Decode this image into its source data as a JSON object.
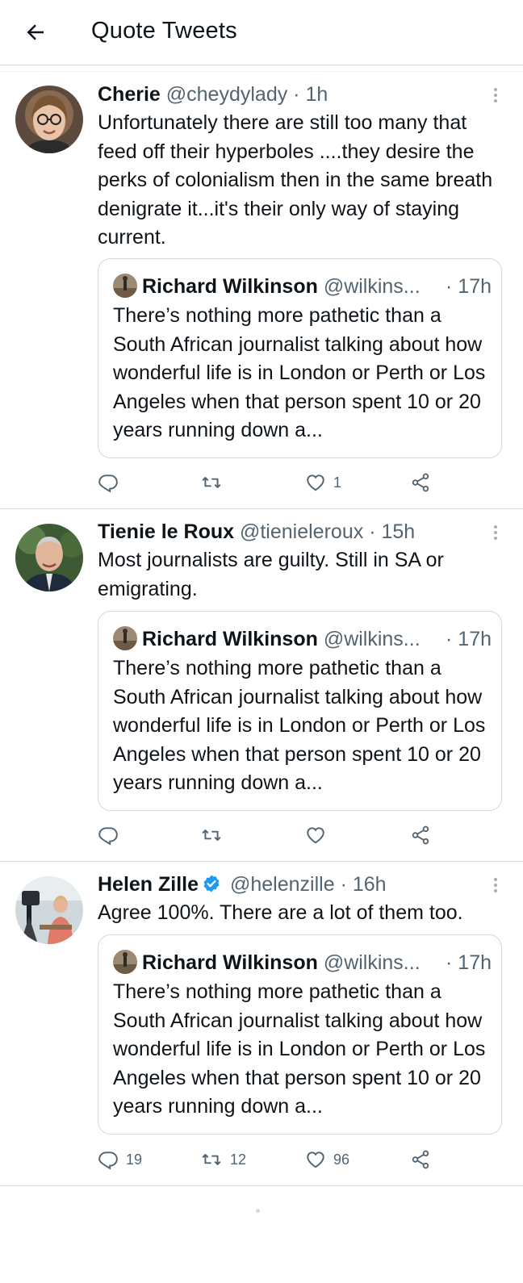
{
  "header": {
    "title": "Quote Tweets",
    "back_icon": "arrow-left-icon"
  },
  "quoted_tweet": {
    "name": "Richard Wilkinson",
    "handle": "@wilkins...",
    "time": "· 17h",
    "text": "There’s nothing more pathetic than a South African journalist talking about how wonderful life is in London or Perth or Los Angeles when that person spent 10 or 20 years running down a..."
  },
  "tweets": [
    {
      "name": "Cherie",
      "handle": "@cheydylady",
      "time": "· 1h",
      "verified": false,
      "text": "Unfortunately there are still too many that feed off their hyperboles ....they desire the perks of colonialism then in the same breath denigrate it...it's their only way of staying current.",
      "reply_count": "",
      "retweet_count": "",
      "like_count": "1"
    },
    {
      "name": "Tienie le Roux",
      "handle": "@tienieleroux",
      "time": "· 15h",
      "verified": false,
      "text": "Most journalists are guilty. Still in SA or emigrating.",
      "reply_count": "",
      "retweet_count": "",
      "like_count": ""
    },
    {
      "name": "Helen Zille",
      "handle": "@helenzille",
      "time": "· 16h",
      "verified": true,
      "text": "Agree 100%. There are a lot of them too.",
      "reply_count": "19",
      "retweet_count": "12",
      "like_count": "96"
    }
  ],
  "colors": {
    "text_primary": "#0f1419",
    "text_secondary": "#536471",
    "border": "#cfd9de",
    "verified_blue": "#1d9bf0"
  }
}
